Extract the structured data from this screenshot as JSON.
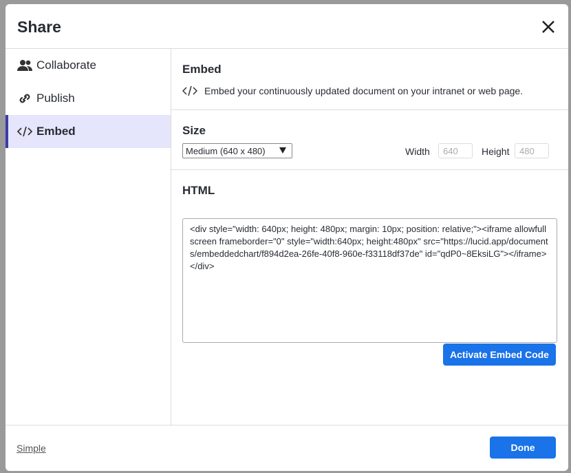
{
  "dialog": {
    "title": "Share",
    "close_icon": "close-icon"
  },
  "sidebar": {
    "items": [
      {
        "label": "Collaborate",
        "icon": "people-icon"
      },
      {
        "label": "Publish",
        "icon": "link-icon"
      },
      {
        "label": "Embed",
        "icon": "code-icon",
        "active": true
      }
    ]
  },
  "embed": {
    "heading": "Embed",
    "description": "Embed your continuously updated document on your intranet or web page."
  },
  "size": {
    "heading": "Size",
    "selected": "Medium (640 x 480)",
    "width_label": "Width",
    "width_value": "640",
    "height_label": "Height",
    "height_value": "480"
  },
  "html": {
    "heading": "HTML",
    "code": "<div style=\"width: 640px; height: 480px; margin: 10px; position: relative;\"><iframe allowfullscreen frameborder=\"0\" style=\"width:640px; height:480px\" src=\"https://lucid.app/documents/embeddedchart/f894d2ea-26fe-40f8-960e-f33118df37de\" id=\"qdP0~8EksiLG\"></iframe></div>",
    "activate_label": "Activate Embed Code"
  },
  "footer": {
    "simple_label": "Simple",
    "done_label": "Done"
  },
  "colors": {
    "accent": "#1a73e8",
    "active_bg": "#e5e5fb"
  }
}
